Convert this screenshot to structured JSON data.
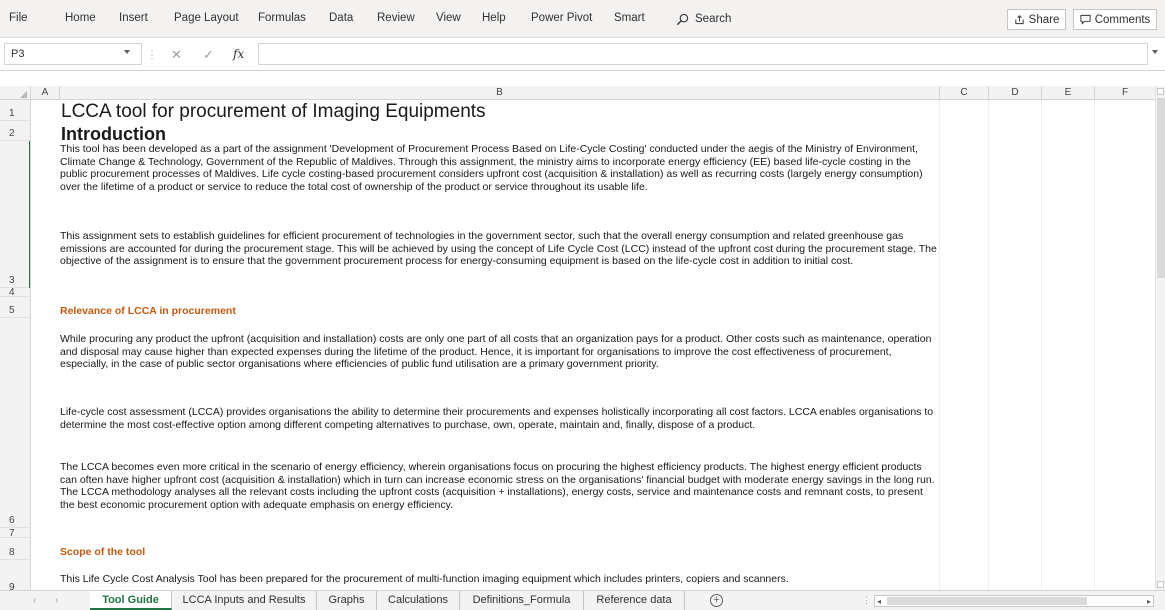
{
  "menu": {
    "items": [
      "File",
      "Home",
      "Insert",
      "Page Layout",
      "Formulas",
      "Data",
      "Review",
      "View",
      "Help",
      "Power Pivot",
      "Smart"
    ],
    "search_label": "Search",
    "share_label": "Share",
    "comments_label": "Comments"
  },
  "formula_bar": {
    "name_box": "P3",
    "cancel_glyph": "✕",
    "enter_glyph": "✓",
    "fx_label": "fx",
    "content": ""
  },
  "columns": [
    "A",
    "B",
    "C",
    "D",
    "E",
    "F"
  ],
  "rows": [
    "1",
    "2",
    "3",
    "4",
    "5",
    "6",
    "7",
    "8",
    "9"
  ],
  "content": {
    "title": "LCCA tool for procurement of Imaging Equipments",
    "intro_heading": "Introduction",
    "intro_p1": "This tool has been developed as a part of the assignment 'Development of Procurement Process Based on Life-Cycle Costing' conducted under the aegis of the Ministry of Environment, Climate Change & Technology, Government of the Republic of Maldives. Through this assignment, the ministry aims to incorporate energy efficiency (EE) based life-cycle costing in the public procurement processes of Maldives. Life cycle costing-based procurement considers upfront cost (acquisition & installation) as well as recurring costs (largely energy consumption) over the lifetime of a product or service to reduce the total cost of ownership of the product or service throughout its usable life.",
    "intro_p2": "This assignment sets to establish guidelines for efficient procurement of technologies in the government sector, such that the overall energy consumption and related greenhouse gas emissions are accounted for during the procurement stage. This will be achieved by using the concept of Life Cycle Cost (LCC) instead of the upfront cost during the procurement stage. The objective of the assignment is to ensure that the government procurement process for energy-consuming equipment is based on the life-cycle cost in addition to initial cost.",
    "relevance_heading": "Relevance of LCCA in procurement",
    "relevance_p1": "While procuring any product the upfront (acquisition and installation) costs are only one part of all costs that an organization pays for a product. Other costs such as maintenance, operation and disposal may cause higher than expected expenses during the lifetime of the product. Hence, it is important for organisations to improve the cost effectiveness of procurement, especially, in the case of public sector organisations where efficiencies of public fund utilisation are a primary government priority.",
    "relevance_p2": "Life-cycle cost assessment (LCCA) provides organisations the ability to determine their procurements and expenses holistically incorporating all cost factors. LCCA enables organisations to determine the most cost-effective option among different competing alternatives to purchase, own, operate, maintain and, finally, dispose of a product.",
    "relevance_p3": "The LCCA  becomes even more critical in the scenario of energy efficiency, wherein organisations focus on procuring the highest efficiency products. The highest energy efficient products can often have higher upfront cost (acquisition & installation) which in turn can increase economic stress on the organisations' financial budget with moderate energy savings in the long run. The LCCA methodology analyses all the relevant costs including the upfront costs (acquisition + installations), energy costs, service and maintenance costs and remnant costs, to present the best economic procurement option with adequate emphasis on energy efficiency.",
    "scope_heading": "Scope of the tool",
    "scope_p1": "This Life Cycle Cost Analysis Tool has been prepared for the procurement of multi-function imaging equipment which includes printers, copiers and scanners."
  },
  "sheet_tabs": [
    "Tool Guide",
    "LCCA Inputs and Results",
    "Graphs",
    "Calculations",
    "Definitions_Formula",
    "Reference data"
  ],
  "active_tab": "Tool Guide",
  "colors": {
    "accent_green": "#217346",
    "section_orange": "#c55a11"
  },
  "icons": [
    "search-icon",
    "share-icon",
    "comment-icon",
    "add-sheet-icon"
  ]
}
